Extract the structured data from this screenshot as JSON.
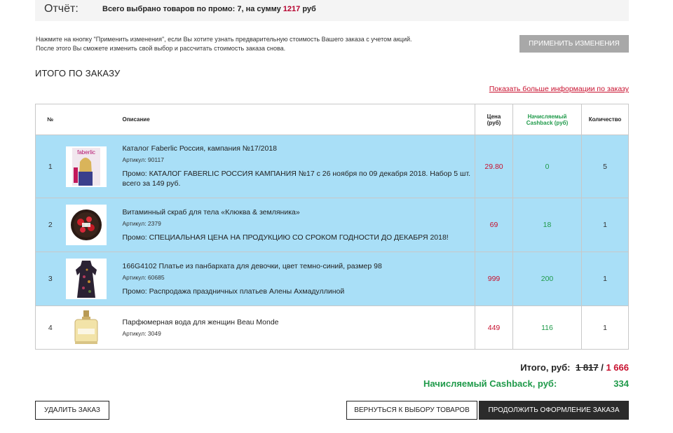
{
  "report": {
    "label": "Отчёт:",
    "summary_prefix": "Всего выбрано товаров по промо: 7, на сумму ",
    "summary_amount": "1217",
    "summary_suffix": " руб"
  },
  "hint": {
    "line1": "Нажмите на кнопку \"Применить изменения\", если Вы хотите узнать предварительную стоимость Вашего заказа с учетом акций.",
    "line2": "После этого Вы сможете изменить свой выбор и рассчитать стоимость заказа снова."
  },
  "apply_button": "ПРИМЕНИТЬ ИЗМЕНЕНИЯ",
  "section_title": "ИТОГО ПО ЗАКАЗУ",
  "more_info_link": "Показать больше информации по заказу",
  "table": {
    "headers": {
      "num": "№",
      "description": "Описание",
      "price_line1": "Цена",
      "price_line2": "(руб)",
      "cashback_line1": "Начисляемый",
      "cashback_line2": "Cashback (руб)",
      "quantity": "Количество"
    },
    "rows": [
      {
        "num": "1",
        "title": "Каталог Faberlic Россия, кампания №17/2018",
        "sku": "Артикул: 90117",
        "promo": "Промо: КАТАЛОГ FABERLIC РОССИЯ КАМПАНИЯ №17 с 26 ноября по 09 декабря 2018. Набор 5 шт. всего за 149 руб.",
        "price": "29.80",
        "cashback": "0",
        "quantity": "5",
        "thumb_text": "faberlic"
      },
      {
        "num": "2",
        "title": "Витаминный скраб для тела «Клюква & земляника»",
        "sku": "Артикул: 2379",
        "promo": "Промо: СПЕЦИАЛЬНАЯ ЦЕНА НА ПРОДУКЦИЮ СО СРОКОМ ГОДНОСТИ ДО ДЕКАБРЯ 2018!",
        "price": "69",
        "cashback": "18",
        "quantity": "1"
      },
      {
        "num": "3",
        "title": "166G4102 Платье из панбархата для девочки, цвет темно-синий, размер 98",
        "sku": "Артикул: 60685",
        "promo": "Промо: Распродажа праздничных платьев Алены Ахмадуллиной",
        "price": "999",
        "cashback": "200",
        "quantity": "1"
      },
      {
        "num": "4",
        "title": "Парфюмерная вода для женщин Beau Monde",
        "sku": "Артикул: 3049",
        "promo": "",
        "price": "449",
        "cashback": "116",
        "quantity": "1"
      }
    ]
  },
  "totals": {
    "label": "Итого, руб:",
    "old": "1 817",
    "separator": " / ",
    "new": "1 666",
    "cashback_label": "Начисляемый Cashback, руб:",
    "cashback_value": "334"
  },
  "buttons": {
    "delete": "УДАЛИТЬ ЗАКАЗ",
    "back": "ВЕРНУТЬСЯ К ВЫБОРУ ТОВАРОВ",
    "continue": "ПРОДОЛЖИТЬ ОФОРМЛЕНИЕ ЗАКАЗА"
  },
  "colors": {
    "accent_red": "#c8102e",
    "cashback_green": "#1f9a4a",
    "promo_row": "#a9dff7"
  }
}
